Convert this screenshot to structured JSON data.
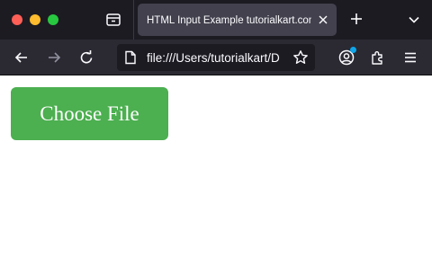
{
  "browser": {
    "tab": {
      "title": "HTML Input Example tutorialkart.com"
    },
    "address_bar": {
      "url": "file:///Users/tutorialkart/D"
    }
  },
  "page": {
    "choose_file_button": {
      "label": "Choose File"
    }
  },
  "colors": {
    "titlebar_bg": "#1c1b22",
    "toolbar_bg": "#2b2a33",
    "tab_bg": "#42414d",
    "icon_color": "#fbfbfe",
    "button_bg": "#4caf50",
    "notification_dot": "#0ea5e9"
  },
  "icons": {
    "window_controls": [
      "close-window-icon",
      "minimize-window-icon",
      "zoom-window-icon"
    ],
    "toolbar": [
      "back-arrow-icon",
      "forward-arrow-icon",
      "reload-icon",
      "page-icon",
      "bookmark-star-icon",
      "account-icon",
      "extensions-icon",
      "hamburger-menu-icon"
    ]
  }
}
